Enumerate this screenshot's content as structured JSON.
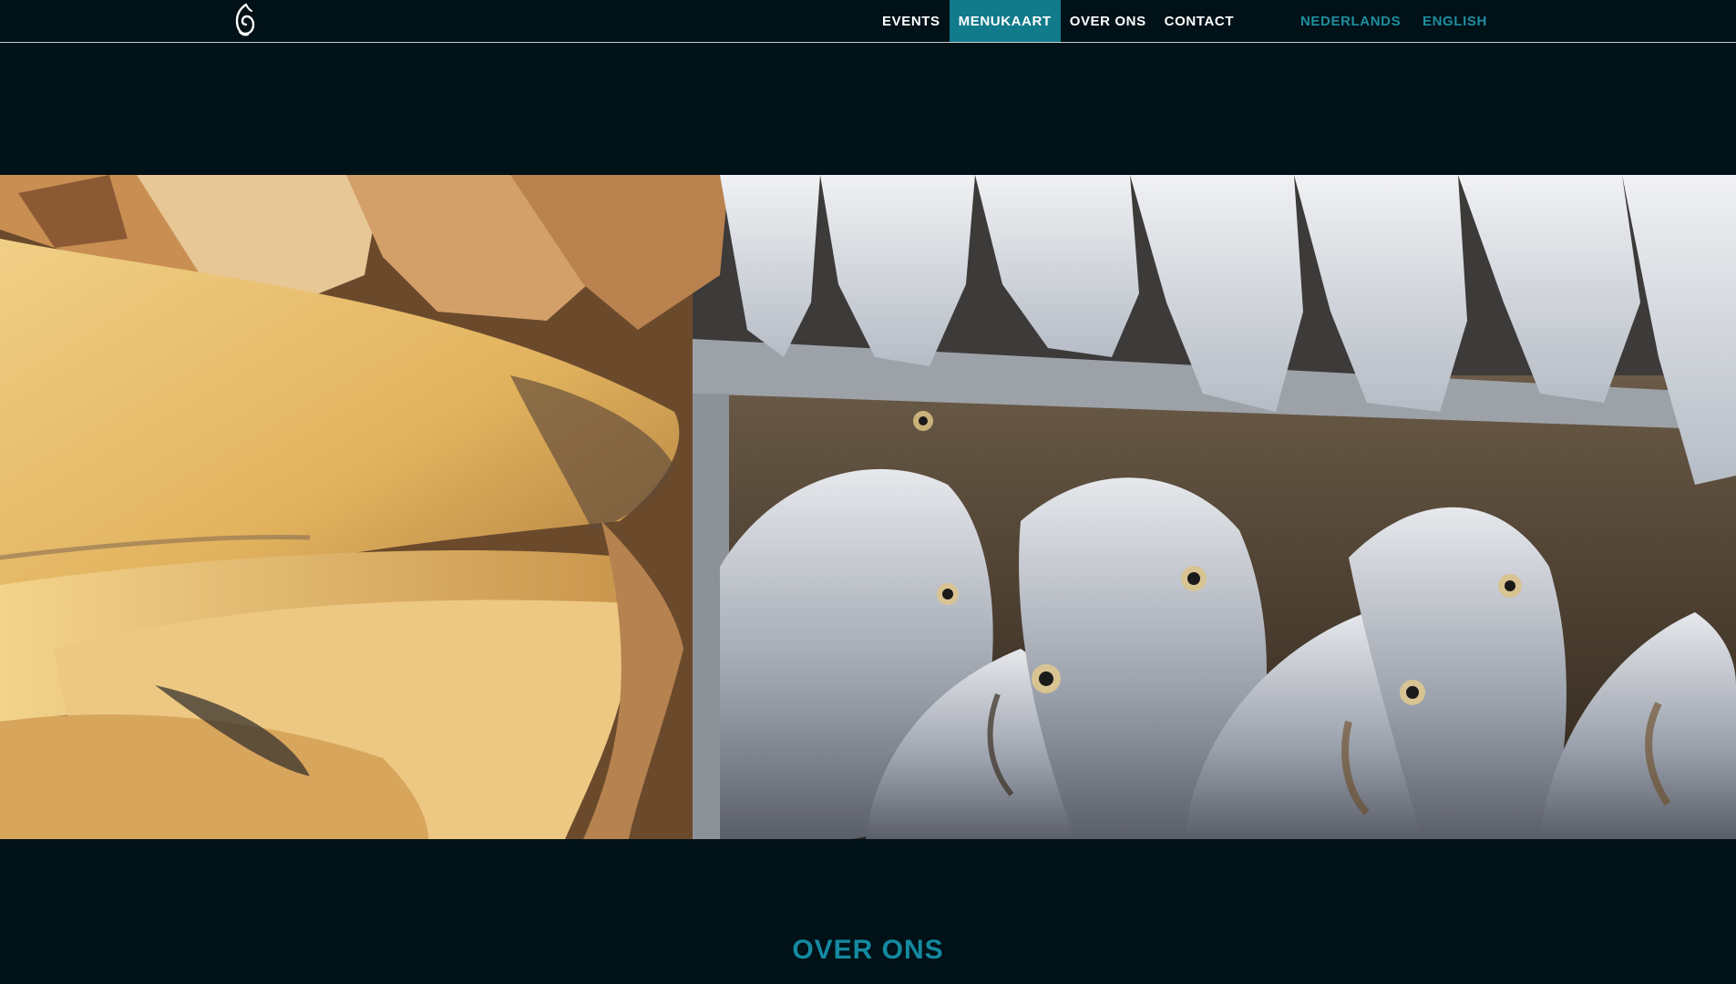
{
  "header": {
    "logo_icon": "flame-drop-logo-icon",
    "nav": {
      "events": "EVENTS",
      "menukaart": "MENUKAART",
      "over_ons": "OVER ONS",
      "contact": "CONTACT"
    },
    "active_item": "MENUKAART",
    "languages": {
      "nl": "NEDERLANDS",
      "en": "ENGLISH"
    }
  },
  "colors": {
    "background": "#001117",
    "accent": "#117a8b",
    "accent_text": "#1f8ea0",
    "nav_text": "#ffffff"
  },
  "hero": {
    "image_subject": "dried fish at market"
  },
  "section": {
    "title": "OVER ONS"
  }
}
